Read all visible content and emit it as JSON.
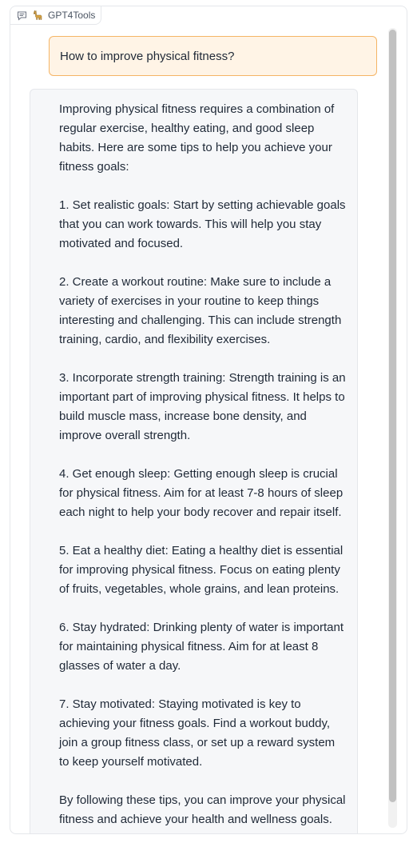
{
  "app": {
    "label": "GPT4Tools"
  },
  "conversation": {
    "user_message": "How to improve physical fitness?",
    "bot_paragraphs": [
      "Improving physical fitness requires a combination of regular exercise, healthy eating, and good sleep habits. Here are some tips to help you achieve your fitness goals:",
      "1. Set realistic goals: Start by setting achievable goals that you can work towards. This will help you stay motivated and focused.",
      "2. Create a workout routine: Make sure to include a variety of exercises in your routine to keep things interesting and challenging. This can include strength training, cardio, and flexibility exercises.",
      "3. Incorporate strength training: Strength training is an important part of improving physical fitness. It helps to build muscle mass, increase bone density, and improve overall strength.",
      "4. Get enough sleep: Getting enough sleep is crucial for physical fitness. Aim for at least 7-8 hours of sleep each night to help your body recover and repair itself.",
      "5. Eat a healthy diet: Eating a healthy diet is essential for improving physical fitness. Focus on eating plenty of fruits, vegetables, whole grains, and lean proteins.",
      "6. Stay hydrated: Drinking plenty of water is important for maintaining physical fitness. Aim for at least 8 glasses of water a day.",
      "7. Stay motivated: Staying motivated is key to achieving your fitness goals. Find a workout buddy, join a group fitness class, or set up a reward system to keep yourself motivated.",
      "By following these tips, you can improve your physical fitness and achieve your health and wellness goals."
    ]
  },
  "icons": {
    "chat": "chat-bubble-icon",
    "logo": "llama-emoji-icon"
  },
  "colors": {
    "user_bubble_bg": "#fff4e6",
    "user_bubble_border": "#f5b566",
    "bot_bubble_bg": "#f6f7f9",
    "border": "#e5e7eb"
  }
}
